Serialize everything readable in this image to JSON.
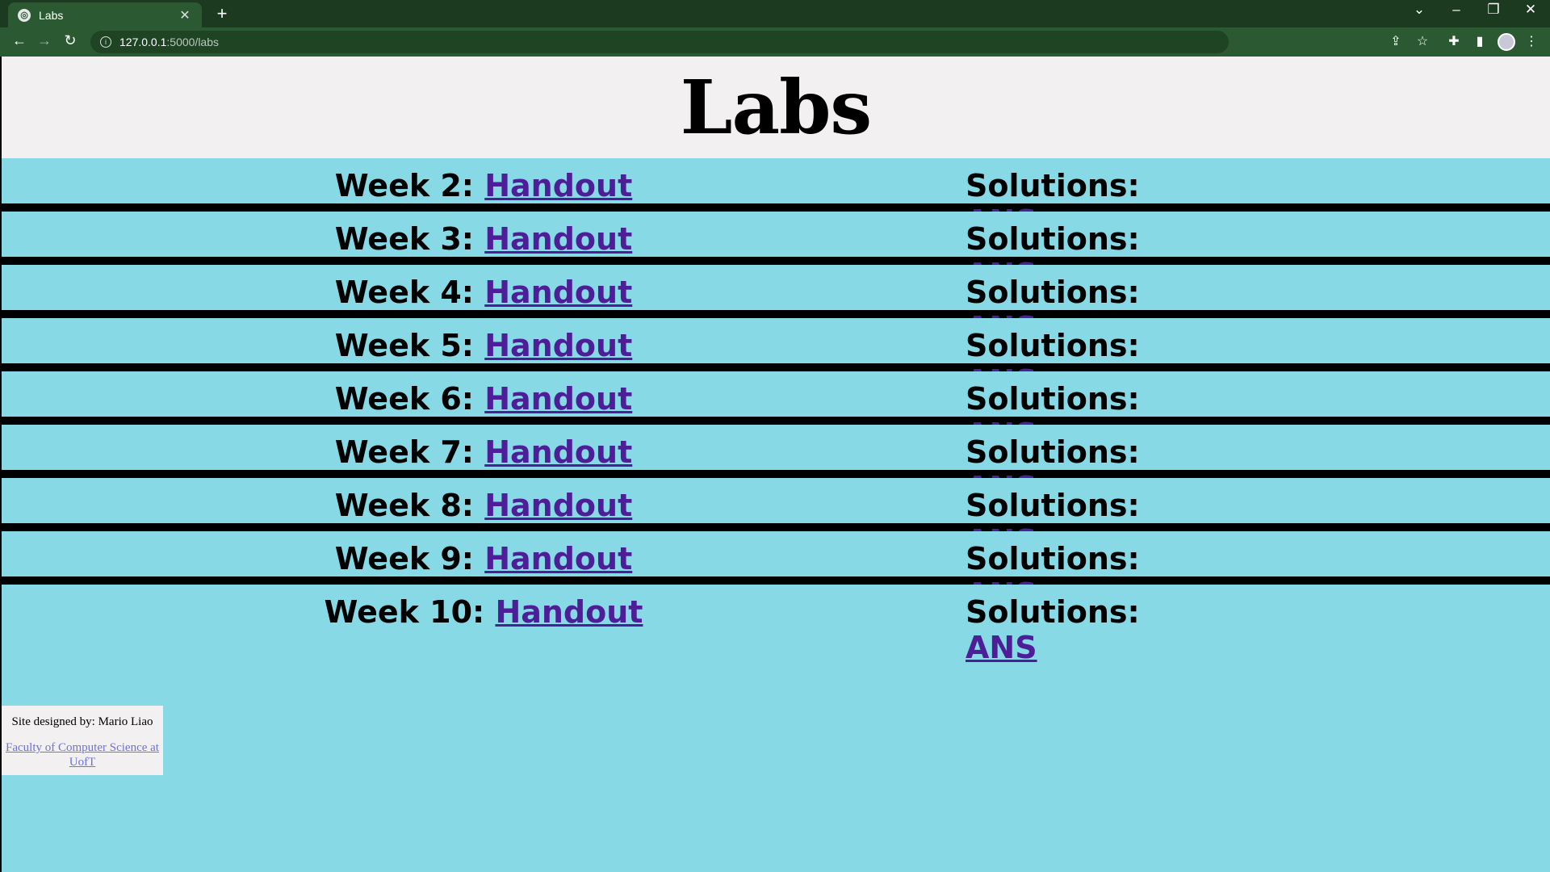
{
  "browser": {
    "tab_title": "Labs",
    "url_host": "127.0.0.1",
    "url_path": ":5000/labs"
  },
  "page": {
    "heading": "Labs",
    "labs": [
      {
        "week": "Week 2:",
        "handout": "Handout",
        "solutions": "Solutions:",
        "ans": "ANS"
      },
      {
        "week": "Week 3:",
        "handout": "Handout",
        "solutions": "Solutions:",
        "ans": "ANS"
      },
      {
        "week": "Week 4:",
        "handout": "Handout",
        "solutions": "Solutions:",
        "ans": "ANS"
      },
      {
        "week": "Week 5:",
        "handout": "Handout",
        "solutions": "Solutions:",
        "ans": "ANS"
      },
      {
        "week": "Week 6:",
        "handout": "Handout",
        "solutions": "Solutions:",
        "ans": "ANS"
      },
      {
        "week": "Week 7:",
        "handout": "Handout",
        "solutions": "Solutions:",
        "ans": "ANS"
      },
      {
        "week": "Week 8:",
        "handout": "Handout",
        "solutions": "Solutions:",
        "ans": "ANS"
      },
      {
        "week": "Week 9:",
        "handout": "Handout",
        "solutions": "Solutions:",
        "ans": "ANS"
      },
      {
        "week": "Week 10:",
        "handout": "Handout",
        "solutions": "Solutions:",
        "ans": "ANS"
      }
    ],
    "footer": {
      "designer": "Site designed by: Mario Liao",
      "link": "Faculty of Computer Science at UofT"
    }
  },
  "colors": {
    "background": "#86d9e5",
    "header_bg": "#f2f0f1",
    "link": "#4d1e98",
    "chrome": "#2b5a32"
  }
}
